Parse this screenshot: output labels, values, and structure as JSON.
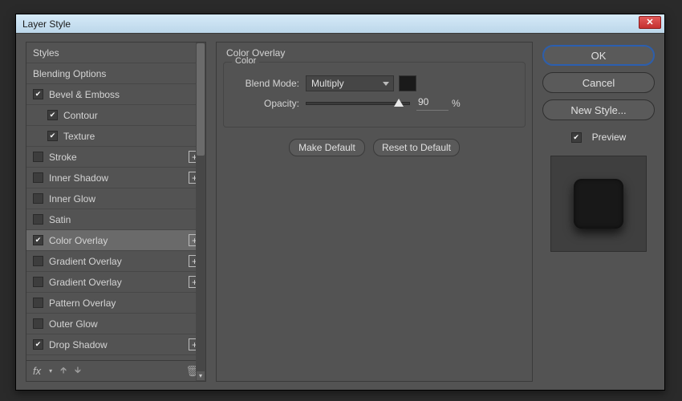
{
  "window": {
    "title": "Layer Style"
  },
  "sidebar": {
    "items": [
      {
        "label": "Styles",
        "hasCheckbox": false
      },
      {
        "label": "Blending Options",
        "hasCheckbox": false
      },
      {
        "label": "Bevel & Emboss",
        "hasCheckbox": true,
        "checked": true
      },
      {
        "label": "Contour",
        "hasCheckbox": true,
        "checked": true,
        "indent": true
      },
      {
        "label": "Texture",
        "hasCheckbox": true,
        "checked": true,
        "indent": true
      },
      {
        "label": "Stroke",
        "hasCheckbox": true,
        "checked": false,
        "plus": true
      },
      {
        "label": "Inner Shadow",
        "hasCheckbox": true,
        "checked": false,
        "plus": true
      },
      {
        "label": "Inner Glow",
        "hasCheckbox": true,
        "checked": false
      },
      {
        "label": "Satin",
        "hasCheckbox": true,
        "checked": false
      },
      {
        "label": "Color Overlay",
        "hasCheckbox": true,
        "checked": true,
        "plus": true,
        "selected": true
      },
      {
        "label": "Gradient Overlay",
        "hasCheckbox": true,
        "checked": false,
        "plus": true
      },
      {
        "label": "Gradient Overlay",
        "hasCheckbox": true,
        "checked": false,
        "plus": true
      },
      {
        "label": "Pattern Overlay",
        "hasCheckbox": true,
        "checked": false
      },
      {
        "label": "Outer Glow",
        "hasCheckbox": true,
        "checked": false
      },
      {
        "label": "Drop Shadow",
        "hasCheckbox": true,
        "checked": true,
        "plus": true
      }
    ],
    "fx_label": "fx"
  },
  "panel": {
    "title": "Color Overlay",
    "group_label": "Color",
    "blend_mode_label": "Blend Mode:",
    "blend_mode_value": "Multiply",
    "opacity_label": "Opacity:",
    "opacity_value": "90",
    "opacity_unit": "%",
    "make_default": "Make Default",
    "reset_default": "Reset to Default",
    "swatch_color": "#141414"
  },
  "actions": {
    "ok": "OK",
    "cancel": "Cancel",
    "new_style": "New Style...",
    "preview_label": "Preview",
    "preview_checked": true
  }
}
